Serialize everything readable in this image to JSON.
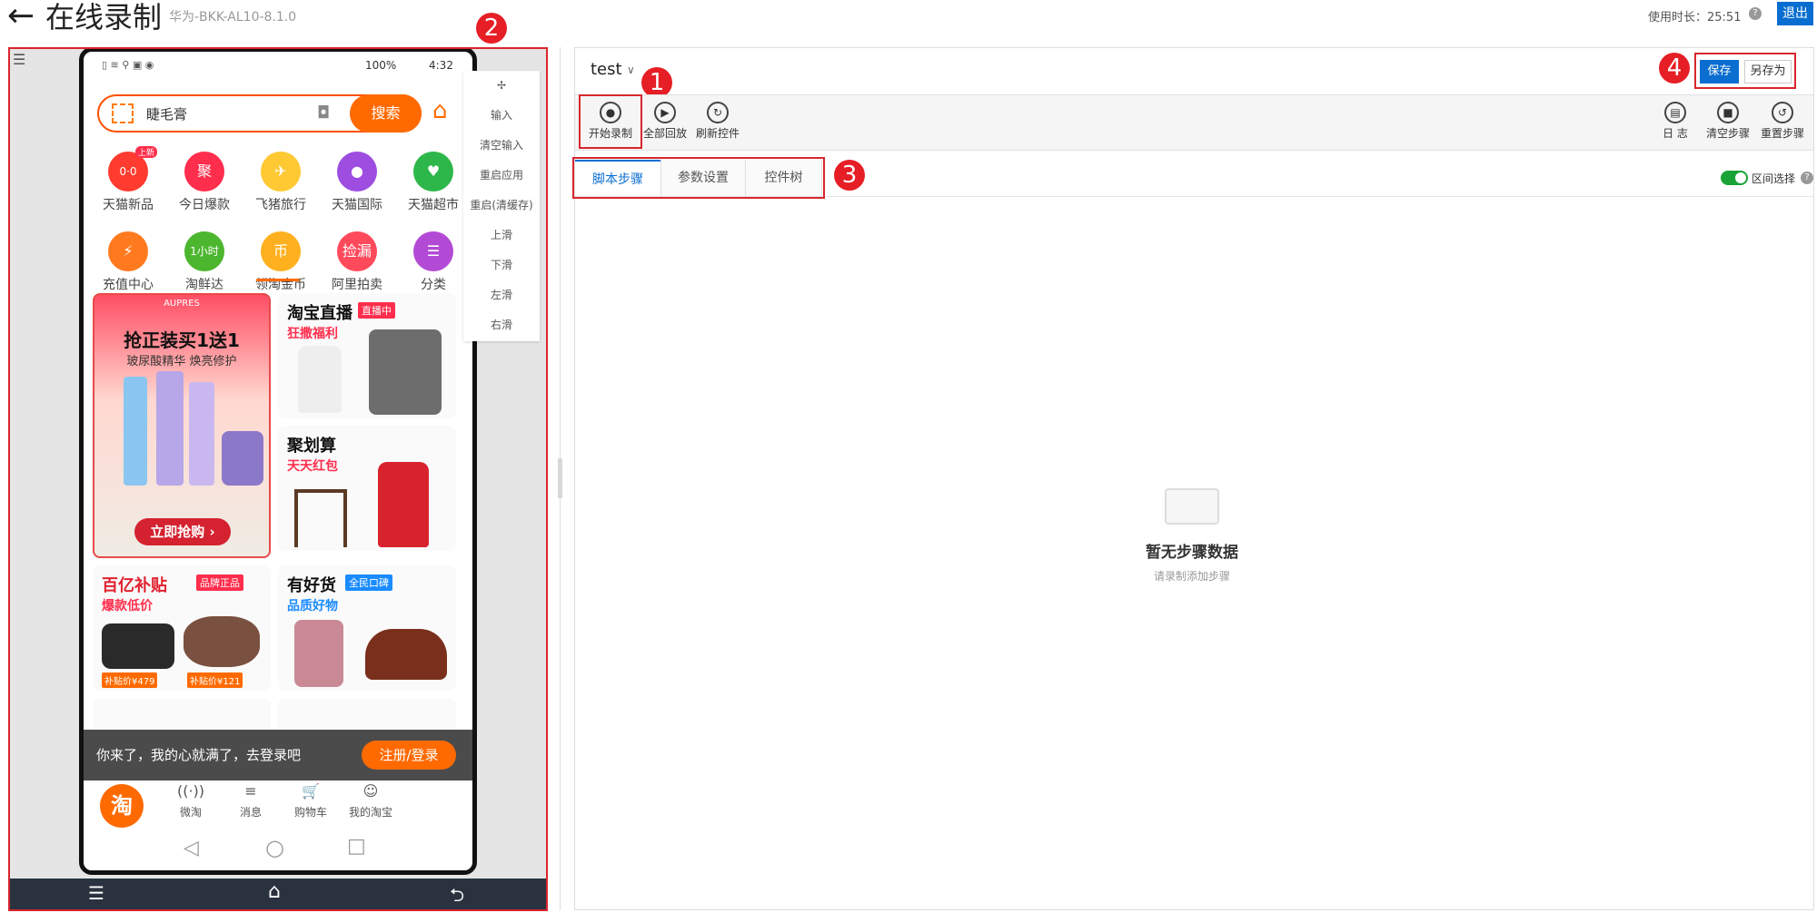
{
  "header": {
    "back_icon": "arrow-left",
    "title": "在线录制",
    "device": "华为-BKK-AL10-8.1.0",
    "usage_label": "使用时长：25:51",
    "help_glyph": "?",
    "exit_label": "退出"
  },
  "annotations": [
    "1",
    "2",
    "3",
    "4"
  ],
  "phone": {
    "status": {
      "battery": "100%",
      "time": "4:32"
    },
    "search": {
      "query": "睫毛膏",
      "button": "搜索"
    },
    "categories": [
      {
        "label": "天猫新品",
        "glyph": "0·0",
        "color": "#ff3b30",
        "badge": "上新"
      },
      {
        "label": "今日爆款",
        "glyph": "聚",
        "color": "#ff2e4d"
      },
      {
        "label": "飞猪旅行",
        "glyph": "✈",
        "color": "#ffc933"
      },
      {
        "label": "天猫国际",
        "glyph": "●",
        "color": "#9d4de0"
      },
      {
        "label": "天猫超市",
        "glyph": "♥",
        "color": "#2db74a"
      },
      {
        "label": "充值中心",
        "glyph": "⚡",
        "color": "#ff7a1f"
      },
      {
        "label": "淘鲜达",
        "glyph": "1小时",
        "color": "#4db62f"
      },
      {
        "label": "领淘金币",
        "glyph": "币",
        "color": "#ffb01f"
      },
      {
        "label": "阿里拍卖",
        "glyph": "捡漏",
        "color": "#ff4a5c"
      },
      {
        "label": "分类",
        "glyph": "☰",
        "color": "#b24ad6"
      }
    ],
    "banner": {
      "brand": "AUPRES",
      "headline": "抢正装买1送1",
      "sub": "玻尿酸精华 焕亮修护",
      "cta": "立即抢购 ›"
    },
    "live": {
      "title": "淘宝直播",
      "badge": "直播中",
      "sub": "狂撒福利"
    },
    "juhua": {
      "title": "聚划算",
      "sub": "天天红包"
    },
    "baiyi": {
      "title": "百亿补贴",
      "badge": "品牌正品",
      "sub": "爆款低价",
      "price1": "补贴价¥479",
      "price2": "补贴价¥121"
    },
    "youhaohuo": {
      "title": "有好货",
      "badge": "全民口碑",
      "sub": "品质好物"
    },
    "login_bar": {
      "text": "你来了，我的心就满了，去登录吧",
      "button": "注册/登录"
    },
    "bottom_nav": [
      {
        "label": "",
        "icon": "淘"
      },
      {
        "label": "微淘",
        "icon": "((·))"
      },
      {
        "label": "消息",
        "icon": "≡"
      },
      {
        "label": "购物车",
        "icon": "🛒"
      },
      {
        "label": "我的淘宝",
        "icon": "☺"
      }
    ],
    "android_nav": [
      "◁",
      "○",
      "□"
    ]
  },
  "side_menu": {
    "move_icon": "✢",
    "items": [
      "输入",
      "清空输入",
      "重启应用",
      "重启(清缓存)",
      "上滑",
      "下滑",
      "左滑",
      "右滑"
    ]
  },
  "device_navbar": [
    "☰",
    "⌂",
    "⮌"
  ],
  "editor": {
    "script_name": "test",
    "chevron": "∨",
    "tools_left": [
      {
        "label": "开始录制",
        "glyph": "●"
      },
      {
        "label": "全部回放",
        "glyph": "▶"
      },
      {
        "label": "刷新控件",
        "glyph": "↻"
      }
    ],
    "tools_right": [
      {
        "label": "日 志",
        "glyph": "▤"
      },
      {
        "label": "清空步骤",
        "glyph": "■"
      },
      {
        "label": "重置步骤",
        "glyph": "↺"
      }
    ],
    "save_label": "保存",
    "save_as_label": "另存为",
    "tabs": [
      "脚本步骤",
      "参数设置",
      "控件树"
    ],
    "range_select_label": "区间选择",
    "empty": {
      "title": "暂无步骤数据",
      "sub": "请录制添加步骤"
    }
  }
}
